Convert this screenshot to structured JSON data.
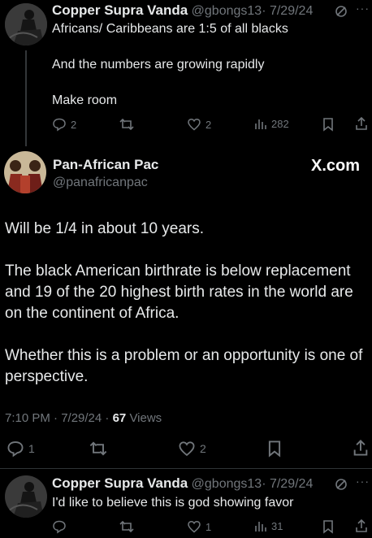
{
  "tweet1": {
    "name": "Copper Supra Vanda",
    "handle": "@gbongs13",
    "date": "· 7/29/24",
    "more": "···",
    "lines": [
      "Africans/ Caribbeans are 1:5 of all blacks",
      "And the numbers are growing rapidly",
      "Make room"
    ],
    "replies": "2",
    "likes": "2",
    "views": "282"
  },
  "main": {
    "name": "Pan-African Pac",
    "handle": "@panafricanpac",
    "watermark": "X.com",
    "paragraphs": [
      "Will be 1/4 in about 10 years.",
      "The black American birthrate is below replacement and 19 of the 20 highest birth rates in the world are on the continent of Africa.",
      "Whether this is a problem or an opportunity is one of perspective."
    ],
    "time": "7:10 PM · 7/29/24 ·",
    "views_count": "67",
    "views_label": "Views",
    "replies": "1",
    "likes": "2"
  },
  "tweet3": {
    "name": "Copper Supra Vanda",
    "handle": "@gbongs13",
    "date": "· 7/29/24",
    "more": "···",
    "text": "I'd like to believe this is god showing favor",
    "likes": "1",
    "views": "31"
  },
  "colors": {
    "background": "#000000",
    "text": "#e7e9ea",
    "muted": "#71767b",
    "divider": "#2f3336"
  }
}
